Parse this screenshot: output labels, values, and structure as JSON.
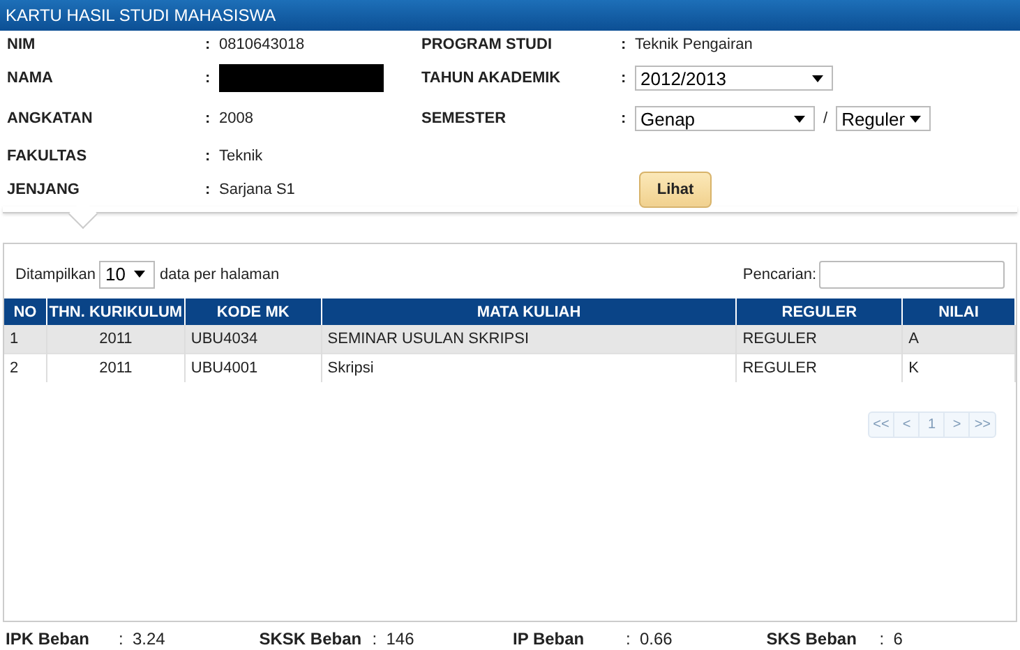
{
  "header": {
    "title": "KARTU HASIL STUDI MAHASISWA"
  },
  "info_left": [
    {
      "label": "NIM",
      "colon": ":",
      "value": "0810643018"
    },
    {
      "label": "NAMA",
      "colon": ":",
      "redacted": true
    },
    {
      "label": "ANGKATAN",
      "colon": ":",
      "value": "2008"
    },
    {
      "label": "FAKULTAS",
      "colon": ":",
      "value": "Teknik"
    },
    {
      "label": "JENJANG",
      "colon": ":",
      "value": "Sarjana S1"
    }
  ],
  "info_right": [
    {
      "label": "PROGRAM STUDI",
      "colon": ":",
      "kind": "text",
      "value": "Teknik Pengairan"
    },
    {
      "label": "TAHUN AKADEMIK",
      "colon": ":",
      "kind": "select",
      "value": "2012/2013"
    },
    {
      "label": "SEMESTER",
      "colon": ":",
      "kind": "select_pair",
      "value": "Genap",
      "separator": "/",
      "value_2": "Reguler"
    }
  ],
  "submit_button": "Lihat",
  "table_controls": {
    "show_prefix": "Ditampilkan",
    "page_size": "10",
    "show_suffix": "data per halaman",
    "search_label": "Pencarian:"
  },
  "table": {
    "columns": [
      "NO",
      "THN. KURIKULUM",
      "KODE MK",
      "MATA KULIAH",
      "REGULER",
      "NILAI"
    ],
    "rows": [
      [
        "1",
        "2011",
        "UBU4034",
        "SEMINAR USULAN SKRIPSI",
        "REGULER",
        "A"
      ],
      [
        "2",
        "2011",
        "UBU4001",
        "Skripsi",
        "REGULER",
        "K"
      ]
    ]
  },
  "pagination": [
    {
      "label": "<<",
      "disabled": true
    },
    {
      "label": "<",
      "disabled": true
    },
    {
      "label": "1",
      "disabled": true
    },
    {
      "label": ">",
      "disabled": true
    },
    {
      "label": ">>",
      "disabled": true
    }
  ],
  "summary": [
    {
      "label": "IPK Beban",
      "colon": ":",
      "value": "3.24"
    },
    {
      "label": "SKSK Beban",
      "colon": ":",
      "value": "146"
    },
    {
      "label": "IP Beban",
      "colon": ":",
      "value": "0.66"
    },
    {
      "label": "SKS Beban",
      "colon": ":",
      "value": "6"
    }
  ]
}
